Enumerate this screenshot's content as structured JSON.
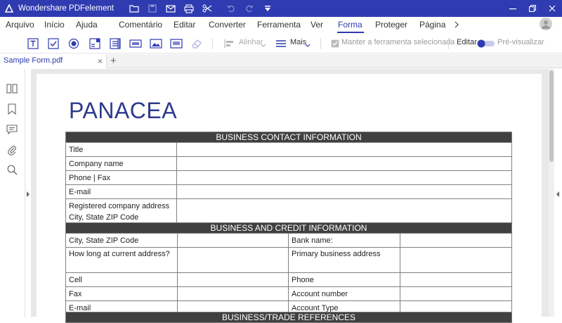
{
  "titlebar": {
    "app_title": "Wondershare PDFelement",
    "icons": [
      "folder-icon",
      "save-icon",
      "mail-icon",
      "print-icon",
      "scissors-icon",
      "undo-icon",
      "redo-icon",
      "dropdown-icon"
    ],
    "window_controls": [
      "minimize-icon",
      "restore-icon",
      "close-icon"
    ],
    "bg_color": "#2f3bb0"
  },
  "menu": {
    "items": [
      {
        "label": "Arquivo"
      },
      {
        "label": "Início"
      },
      {
        "label": "Ajuda"
      },
      {
        "label": "Comentário"
      },
      {
        "label": "Editar"
      },
      {
        "label": "Converter"
      },
      {
        "label": "Ferramenta"
      },
      {
        "label": "Ver"
      },
      {
        "label": "Forma",
        "active": true
      },
      {
        "label": "Proteger"
      },
      {
        "label": "Página"
      }
    ]
  },
  "toolbar": {
    "tools": [
      "text-field-icon",
      "checkbox-icon",
      "radio-button-icon",
      "combo-box-icon",
      "list-box-icon",
      "button-icon",
      "image-field-icon",
      "signature-field-icon",
      "eraser-icon"
    ],
    "align_label": "Alinhar",
    "more_label": "Mais",
    "keep_tool_label": "Manter a ferramenta selecionada",
    "edit_label": "Editar",
    "preview_label": "Pré-visualizar",
    "accent_color": "#2f3bb0"
  },
  "tabs": {
    "file_name": "Sample Form.pdf",
    "close_glyph": "×",
    "add_glyph": "+"
  },
  "sidebar": {
    "icons": [
      "thumbnails-icon",
      "bookmark-icon",
      "comment-icon",
      "attachment-icon",
      "search-icon"
    ]
  },
  "document": {
    "brand": "PANACEA",
    "contact": {
      "header": "BUSINESS CONTACT INFORMATION",
      "rows": [
        {
          "label": "Title"
        },
        {
          "label": "Company name"
        },
        {
          "label": "Phone | Fax"
        },
        {
          "label": "E-mail"
        },
        {
          "label": "Registered company address\nCity, State ZIP Code"
        }
      ]
    },
    "credit": {
      "header": "BUSINESS AND CREDIT INFORMATION",
      "rows": [
        {
          "left": "City, State ZIP Code",
          "right": "Bank name:"
        },
        {
          "left": "How long at current address?",
          "right": "Primary business address"
        },
        {
          "left": "Cell",
          "right": "Phone"
        },
        {
          "left": "Fax",
          "right": "Account number"
        },
        {
          "left": "E-mail",
          "right": "Account Type"
        }
      ]
    },
    "references_header": "BUSINESS/TRADE REFERENCES"
  }
}
